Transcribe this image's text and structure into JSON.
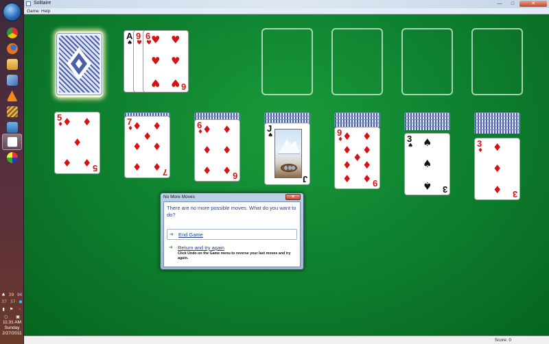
{
  "window": {
    "title": "Solitaire",
    "menu": [
      "Game",
      "Help"
    ],
    "controls": {
      "minimize": "—",
      "maximize": "□",
      "close": "✕"
    }
  },
  "status": {
    "score": "Score: 0"
  },
  "taskbar": {
    "icons": [
      "chrome-icon",
      "firefox-icon",
      "explorer-icon",
      "virtualbox-icon",
      "vlc-icon",
      "tools-icon",
      "network-icon",
      "solitaire-icon",
      "paint-icon"
    ],
    "tray": {
      "row1": [
        "39",
        "96"
      ],
      "row2": [
        "37",
        "37"
      ]
    },
    "clock": {
      "time": "11:31 AM",
      "day": "Sunday",
      "date": "2/27/2011"
    }
  },
  "game": {
    "waste": [
      {
        "rank": "A",
        "suit": "♠",
        "color": "black"
      },
      {
        "rank": "9",
        "suit": "♥",
        "color": "red"
      },
      {
        "rank": "6",
        "suit": "♥",
        "color": "red"
      }
    ],
    "tableau": [
      {
        "rank": "5",
        "suit": "♦",
        "color": "red",
        "face_down": 0
      },
      {
        "rank": "7",
        "suit": "♦",
        "color": "red",
        "face_down": 1
      },
      {
        "rank": "6",
        "suit": "♦",
        "color": "red",
        "face_down": 2
      },
      {
        "rank": "J",
        "suit": "♠",
        "color": "black",
        "face_down": 3
      },
      {
        "rank": "9",
        "suit": "♦",
        "color": "red",
        "face_down": 4
      },
      {
        "rank": "3",
        "suit": "♠",
        "color": "black",
        "face_down": 5
      },
      {
        "rank": "3",
        "suit": "♦",
        "color": "red",
        "face_down": 6
      }
    ],
    "foundations_empty": 4
  },
  "dialog": {
    "title": "No More Moves",
    "close": "✕",
    "message": "There are no more possible moves. What do you want to do?",
    "option1": {
      "label": "End Game"
    },
    "option2": {
      "label": "Return and try again",
      "hint": "Click Undo on the Game menu to reverse your last moves and try again."
    },
    "arrow": "➔"
  }
}
